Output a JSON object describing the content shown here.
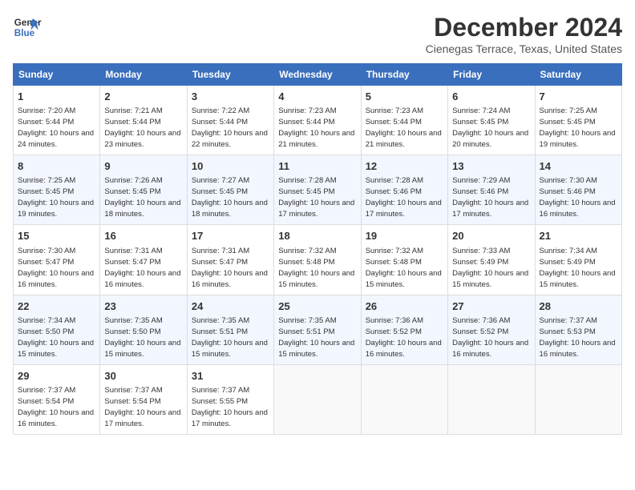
{
  "header": {
    "logo_line1": "General",
    "logo_line2": "Blue",
    "month": "December 2024",
    "location": "Cienegas Terrace, Texas, United States"
  },
  "days_of_week": [
    "Sunday",
    "Monday",
    "Tuesday",
    "Wednesday",
    "Thursday",
    "Friday",
    "Saturday"
  ],
  "weeks": [
    [
      {
        "day": "1",
        "sunrise": "7:20 AM",
        "sunset": "5:44 PM",
        "daylight": "10 hours and 24 minutes."
      },
      {
        "day": "2",
        "sunrise": "7:21 AM",
        "sunset": "5:44 PM",
        "daylight": "10 hours and 23 minutes."
      },
      {
        "day": "3",
        "sunrise": "7:22 AM",
        "sunset": "5:44 PM",
        "daylight": "10 hours and 22 minutes."
      },
      {
        "day": "4",
        "sunrise": "7:23 AM",
        "sunset": "5:44 PM",
        "daylight": "10 hours and 21 minutes."
      },
      {
        "day": "5",
        "sunrise": "7:23 AM",
        "sunset": "5:44 PM",
        "daylight": "10 hours and 21 minutes."
      },
      {
        "day": "6",
        "sunrise": "7:24 AM",
        "sunset": "5:45 PM",
        "daylight": "10 hours and 20 minutes."
      },
      {
        "day": "7",
        "sunrise": "7:25 AM",
        "sunset": "5:45 PM",
        "daylight": "10 hours and 19 minutes."
      }
    ],
    [
      {
        "day": "8",
        "sunrise": "7:25 AM",
        "sunset": "5:45 PM",
        "daylight": "10 hours and 19 minutes."
      },
      {
        "day": "9",
        "sunrise": "7:26 AM",
        "sunset": "5:45 PM",
        "daylight": "10 hours and 18 minutes."
      },
      {
        "day": "10",
        "sunrise": "7:27 AM",
        "sunset": "5:45 PM",
        "daylight": "10 hours and 18 minutes."
      },
      {
        "day": "11",
        "sunrise": "7:28 AM",
        "sunset": "5:45 PM",
        "daylight": "10 hours and 17 minutes."
      },
      {
        "day": "12",
        "sunrise": "7:28 AM",
        "sunset": "5:46 PM",
        "daylight": "10 hours and 17 minutes."
      },
      {
        "day": "13",
        "sunrise": "7:29 AM",
        "sunset": "5:46 PM",
        "daylight": "10 hours and 17 minutes."
      },
      {
        "day": "14",
        "sunrise": "7:30 AM",
        "sunset": "5:46 PM",
        "daylight": "10 hours and 16 minutes."
      }
    ],
    [
      {
        "day": "15",
        "sunrise": "7:30 AM",
        "sunset": "5:47 PM",
        "daylight": "10 hours and 16 minutes."
      },
      {
        "day": "16",
        "sunrise": "7:31 AM",
        "sunset": "5:47 PM",
        "daylight": "10 hours and 16 minutes."
      },
      {
        "day": "17",
        "sunrise": "7:31 AM",
        "sunset": "5:47 PM",
        "daylight": "10 hours and 16 minutes."
      },
      {
        "day": "18",
        "sunrise": "7:32 AM",
        "sunset": "5:48 PM",
        "daylight": "10 hours and 15 minutes."
      },
      {
        "day": "19",
        "sunrise": "7:32 AM",
        "sunset": "5:48 PM",
        "daylight": "10 hours and 15 minutes."
      },
      {
        "day": "20",
        "sunrise": "7:33 AM",
        "sunset": "5:49 PM",
        "daylight": "10 hours and 15 minutes."
      },
      {
        "day": "21",
        "sunrise": "7:34 AM",
        "sunset": "5:49 PM",
        "daylight": "10 hours and 15 minutes."
      }
    ],
    [
      {
        "day": "22",
        "sunrise": "7:34 AM",
        "sunset": "5:50 PM",
        "daylight": "10 hours and 15 minutes."
      },
      {
        "day": "23",
        "sunrise": "7:35 AM",
        "sunset": "5:50 PM",
        "daylight": "10 hours and 15 minutes."
      },
      {
        "day": "24",
        "sunrise": "7:35 AM",
        "sunset": "5:51 PM",
        "daylight": "10 hours and 15 minutes."
      },
      {
        "day": "25",
        "sunrise": "7:35 AM",
        "sunset": "5:51 PM",
        "daylight": "10 hours and 15 minutes."
      },
      {
        "day": "26",
        "sunrise": "7:36 AM",
        "sunset": "5:52 PM",
        "daylight": "10 hours and 16 minutes."
      },
      {
        "day": "27",
        "sunrise": "7:36 AM",
        "sunset": "5:52 PM",
        "daylight": "10 hours and 16 minutes."
      },
      {
        "day": "28",
        "sunrise": "7:37 AM",
        "sunset": "5:53 PM",
        "daylight": "10 hours and 16 minutes."
      }
    ],
    [
      {
        "day": "29",
        "sunrise": "7:37 AM",
        "sunset": "5:54 PM",
        "daylight": "10 hours and 16 minutes."
      },
      {
        "day": "30",
        "sunrise": "7:37 AM",
        "sunset": "5:54 PM",
        "daylight": "10 hours and 17 minutes."
      },
      {
        "day": "31",
        "sunrise": "7:37 AM",
        "sunset": "5:55 PM",
        "daylight": "10 hours and 17 minutes."
      },
      null,
      null,
      null,
      null
    ]
  ]
}
